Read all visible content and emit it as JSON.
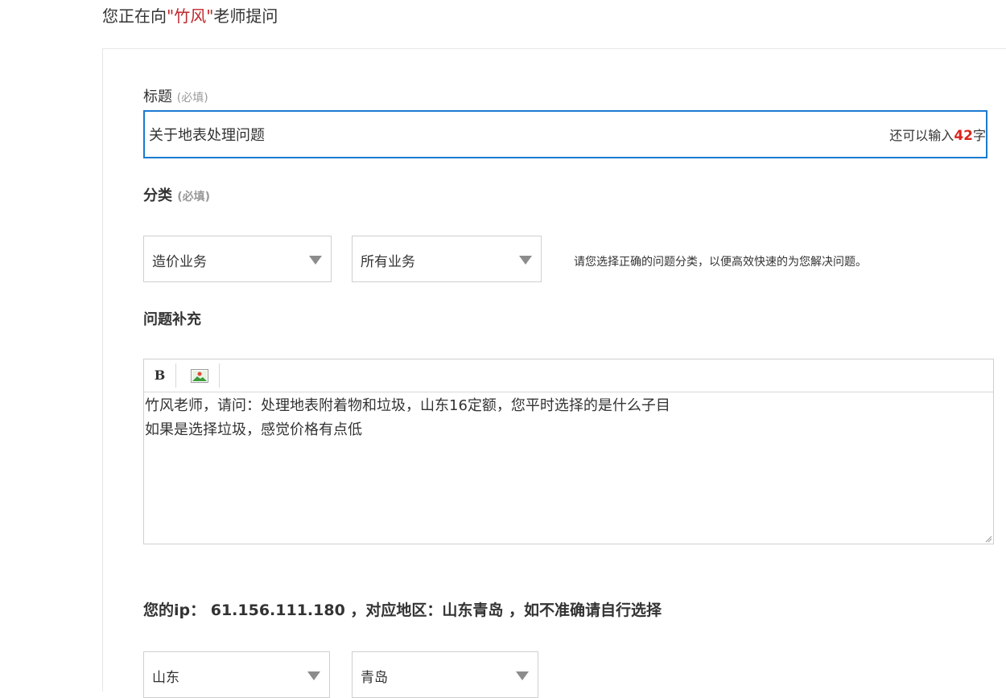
{
  "header": {
    "prefix": "您正在向",
    "teacher": "\"竹风\"",
    "suffix": "老师提问"
  },
  "title_field": {
    "label": "标题",
    "required": "(必填)",
    "value": "关于地表处理问题",
    "counter_prefix": "还可以输入",
    "counter_num": "42",
    "counter_suffix": "字"
  },
  "category": {
    "label": "分类",
    "required": "(必填)",
    "select1": "造价业务",
    "select2": "所有业务",
    "hint": "请您选择正确的问题分类，以便高效快速的为您解决问题。"
  },
  "supplement": {
    "label": "问题补充",
    "bold_button": "B",
    "lines": [
      "竹风老师，请问：处理地表附着物和垃圾，山东16定额，您平时选择的是什么子目",
      "如果是选择垃圾，感觉价格有点低"
    ]
  },
  "location": {
    "ip_text": "您的ip： 61.156.111.180 ，对应地区：山东青岛 ，如不准确请自行选择",
    "province": "山东",
    "city": "青岛"
  },
  "colors": {
    "accent_blue": "#1a7ad1",
    "highlight_red": "#d9251d",
    "teacher_red": "#c0262a"
  }
}
